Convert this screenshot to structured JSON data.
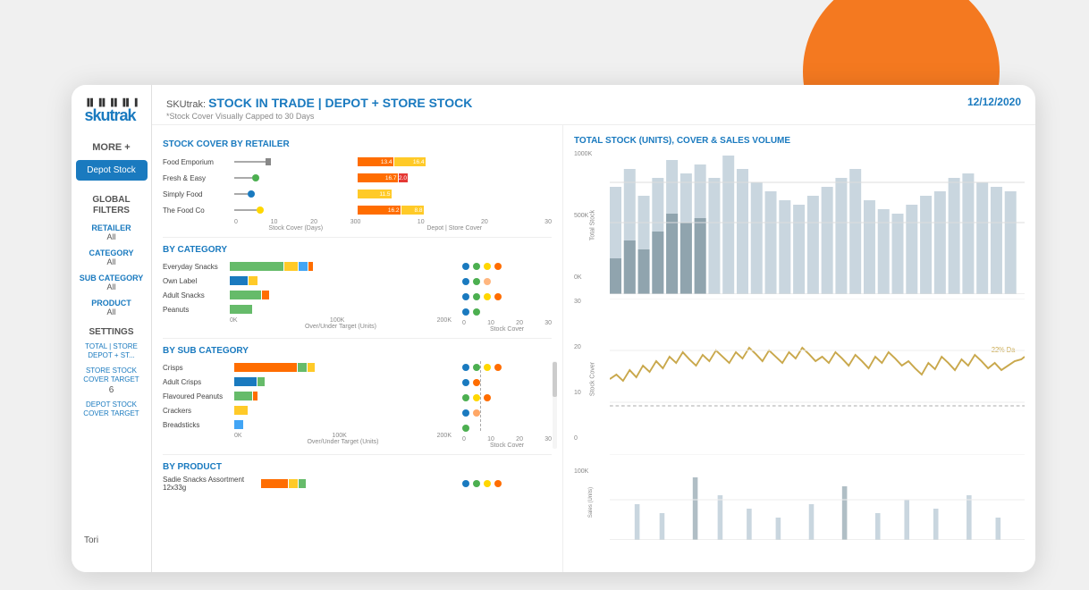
{
  "decorative": {
    "circle_top": "orange",
    "circle_bottom": "orange"
  },
  "sidebar": {
    "logo": "skutrak",
    "more_label": "MORE +",
    "active_button": "Depot Stock",
    "global_filters_label": "GLOBAL\nFILTERS",
    "filters": [
      {
        "label": "RETAILER",
        "value": "All"
      },
      {
        "label": "CATEGORY",
        "value": "All"
      },
      {
        "label": "SUB CATEGORY",
        "value": "All"
      },
      {
        "label": "PRODUCT",
        "value": "All"
      }
    ],
    "settings_label": "SETTINGS",
    "settings": [
      {
        "label": "TOTAL | STORE\nDEPOT + ST...",
        "value": ""
      },
      {
        "label": "STORE STOCK\nCOVER TARGET",
        "value": "6"
      },
      {
        "label": "DEPOT STOCK\nCOVER TARGET",
        "value": ""
      }
    ]
  },
  "header": {
    "prefix": "SKUtrak: ",
    "title": "STOCK IN TRADE | DEPOT + STORE STOCK",
    "subtitle": "*Stock Cover Visually Capped to 30 Days",
    "date": "12/12/2020"
  },
  "left_panel": {
    "retailer_section": {
      "title": "STOCK COVER BY RETAILER",
      "retailers": [
        "Food Emporium",
        "Fresh & Easy",
        "Simply Food",
        "The Food Co"
      ],
      "left_axis": [
        "0",
        "10",
        "20",
        "30"
      ],
      "right_axis": [
        "0",
        "10",
        "20",
        "30"
      ],
      "left_label": "Stock Cover (Days)",
      "right_label": "Depot | Store Cover"
    },
    "category_section": {
      "title": "BY CATEGORY",
      "categories": [
        "Everyday Snacks",
        "Own Label",
        "Adult Snacks",
        "Peanuts"
      ],
      "left_axis": [
        "0K",
        "100K",
        "200K"
      ],
      "left_label": "Over/Under Target (Units)",
      "right_axis": [
        "0",
        "10",
        "20",
        "30"
      ],
      "right_label": "Stock Cover"
    },
    "subcategory_section": {
      "title": "BY SUB CATEGORY",
      "subcategories": [
        "Crisps",
        "Adult Crisps",
        "Flavoured Peanuts",
        "Crackers",
        "Breadsticks"
      ],
      "left_axis": [
        "0K",
        "100K",
        "200K"
      ],
      "left_label": "Over/Under Target (Units)",
      "right_axis": [
        "0",
        "10",
        "20",
        "30"
      ],
      "right_label": "Stock Cover"
    },
    "product_section": {
      "title": "BY PRODUCT",
      "products": [
        "Sadie Snacks Assortment 12x33g"
      ]
    }
  },
  "right_panel": {
    "title": "TOTAL STOCK (Units), COVER & SALES VOLUME",
    "y_axis_total": [
      "1000K",
      "500K",
      "0K"
    ],
    "y_axis_cover": [
      "30",
      "20",
      "10",
      "0"
    ],
    "y_axis_sales": [
      "100K"
    ],
    "cover_target_label": "22% Da"
  },
  "colors": {
    "blue": "#1a7abf",
    "orange": "#F47920",
    "green": "#4CAF50",
    "yellow": "#FFD700",
    "teal": "#008B8B",
    "red": "#E53935",
    "gold": "#C9A84C",
    "light_blue": "#64B5F6",
    "gray_bar": "#B0BEC5",
    "bar_orange": "#FF6D00",
    "bar_yellow": "#FFCA28",
    "bar_green": "#66BB6A",
    "bar_blue": "#42A5F5"
  },
  "tori": "Tori"
}
